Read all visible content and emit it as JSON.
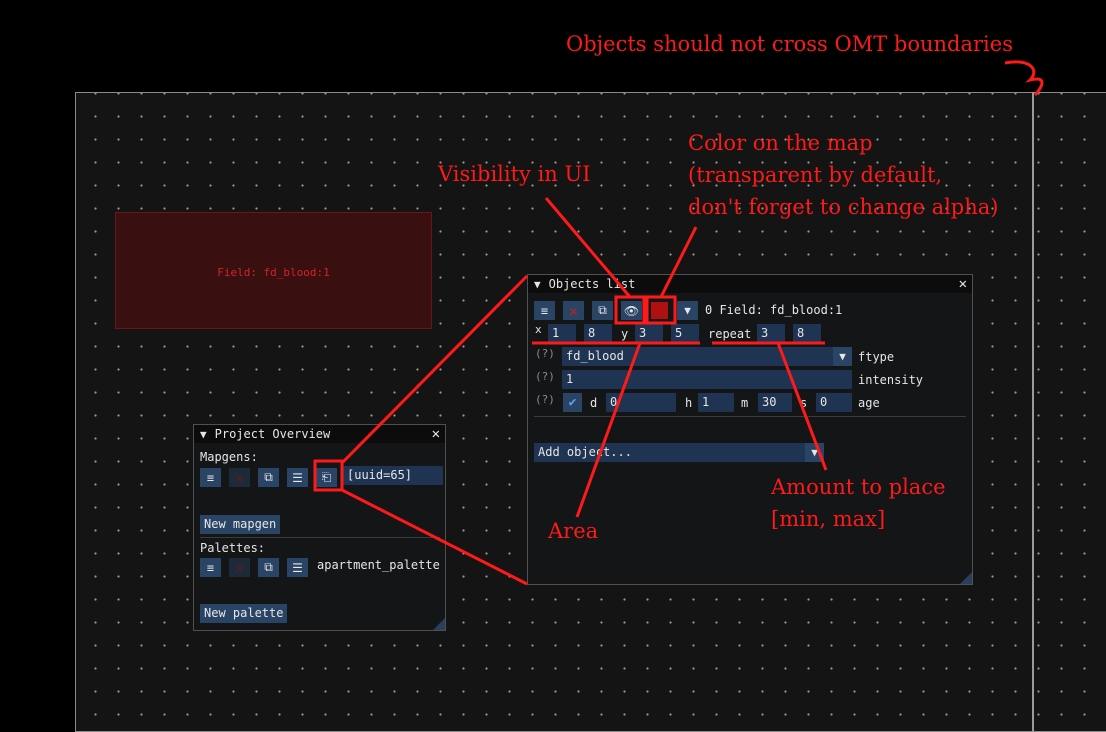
{
  "annotations": {
    "omt": "Objects should not cross OMT boundaries",
    "visibility": "Visibility in UI",
    "color_line1": "Color on the map",
    "color_line2": "(transparent by default,",
    "color_line3": "don't forget to change alpha)",
    "amount_line1": "Amount to place",
    "amount_line2": "[min, max]",
    "area": "Area"
  },
  "field_preview": {
    "label": "Field: fd_blood:1"
  },
  "project_overview": {
    "title": "Project Overview",
    "mapgens_label": "Mapgens:",
    "mapgen_item": "[uuid=65]",
    "new_mapgen": "New mapgen",
    "palettes_label": "Palettes:",
    "palette_item": "apartment_palette",
    "new_palette": "New palette"
  },
  "objects_list": {
    "title": "Objects list",
    "object_label": "0 Field: fd_blood:1",
    "x_label": "x",
    "x_min": "1",
    "x_max": "8",
    "y_label": "y",
    "y_min": "3",
    "y_max": "5",
    "repeat_label": "repeat",
    "repeat_min": "3",
    "repeat_max": "8",
    "help_marker": "(?)",
    "ftype_value": "fd_blood",
    "ftype_label": "ftype",
    "intensity_value": "1",
    "intensity_label": "intensity",
    "age_d_label": "d",
    "age_d": "0",
    "age_h_label": "h",
    "age_h": "1",
    "age_m_label": "m",
    "age_m": "30",
    "age_s_label": "s",
    "age_s": "0",
    "age_label": "age",
    "add_object": "Add object..."
  },
  "colors": {
    "annotation": "#ff1a1a",
    "button": "#2a4466",
    "input": "#1e3452",
    "object_color": "#b01010",
    "field_fill": "#3a0f10"
  },
  "icons": {
    "list": "list-icon",
    "delete": "delete-x-icon",
    "duplicate": "duplicate-icon",
    "details": "details-icon",
    "open": "open-icon",
    "visibility": "eye-icon",
    "dropdown": "triangle-down-icon",
    "collapse": "collapse-triangle-icon",
    "close": "close-icon"
  }
}
